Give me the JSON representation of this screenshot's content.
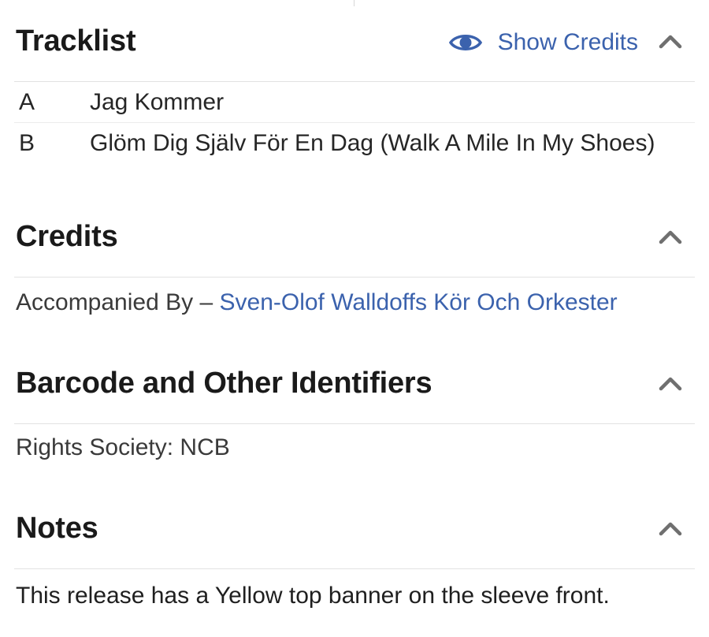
{
  "tracklist": {
    "title": "Tracklist",
    "show_credits_label": "Show Credits",
    "tracks": [
      {
        "position": "A",
        "title": "Jag Kommer"
      },
      {
        "position": "B",
        "title": "Glöm Dig Själv För En Dag (Walk A Mile In My Shoes)"
      }
    ]
  },
  "credits": {
    "title": "Credits",
    "role": "Accompanied By",
    "separator": "–",
    "artist": "Sven-Olof Walldoffs Kör Och Orkester"
  },
  "identifiers": {
    "title": "Barcode and Other Identifiers",
    "text": "Rights Society: NCB"
  },
  "notes": {
    "title": "Notes",
    "text": "This release has a Yellow top banner on the sleeve front."
  },
  "icons": {
    "collapse": "chevron-up-icon",
    "show_credits": "eye-icon"
  },
  "colors": {
    "link": "#3b62ad",
    "divider": "#e2e2e2"
  }
}
